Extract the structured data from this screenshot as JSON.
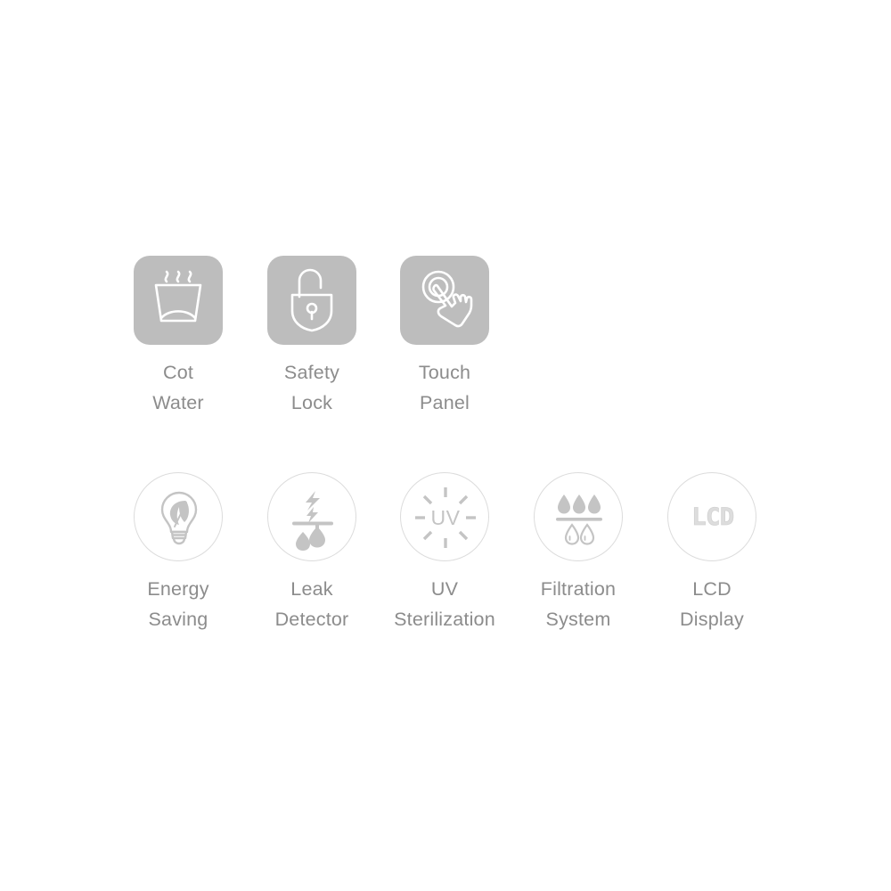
{
  "page": {
    "background": "#ffffff",
    "tile_color": "#bdbdbd",
    "ring_border_color": "#dcdcdc",
    "label_color": "#8c8c8c",
    "icon_white": "#ffffff",
    "icon_soft": "#c4c4c4"
  },
  "rows": [
    {
      "style": "rounded-square-tile",
      "features": [
        {
          "icon": "hot-water-cup-icon",
          "line1": "Cot",
          "line2": "Water"
        },
        {
          "icon": "padlock-icon",
          "line1": "Safety",
          "line2": "Lock"
        },
        {
          "icon": "touch-hand-icon",
          "line1": "Touch",
          "line2": "Panel"
        }
      ]
    },
    {
      "style": "outline-circle",
      "features": [
        {
          "icon": "lightbulb-leaf-icon",
          "line1": "Energy",
          "line2": "Saving"
        },
        {
          "icon": "leak-bolt-drops-icon",
          "line1": "Leak",
          "line2": "Detector"
        },
        {
          "icon": "uv-rays-icon",
          "icon_text": "UV",
          "line1": "UV",
          "line2": "Sterilization"
        },
        {
          "icon": "filtration-drops-icon",
          "line1": "Filtration",
          "line2": "System"
        },
        {
          "icon": "lcd-display-icon",
          "icon_text": "LCD",
          "line1": "LCD",
          "line2": "Display"
        }
      ]
    }
  ]
}
